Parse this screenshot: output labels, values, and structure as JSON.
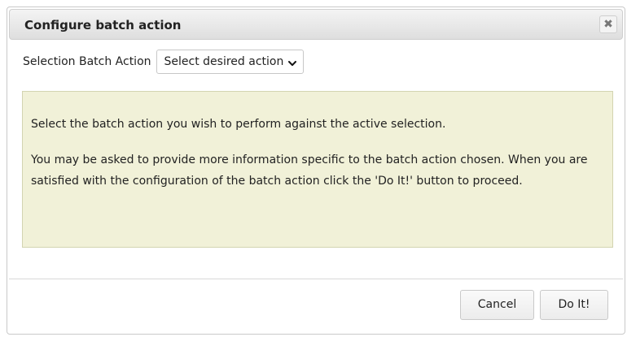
{
  "dialog": {
    "title": "Configure batch action",
    "close_glyph": "✖",
    "close_icon": "close-icon"
  },
  "selection": {
    "label": "Selection Batch Action",
    "selected_value": "Select desired action",
    "dropdown_icon": "chevron-down-icon"
  },
  "info": {
    "paragraph1": "Select the batch action you wish to perform against the active selection.",
    "paragraph2": "You may be asked to provide more information specific to the batch action chosen. When you are satisfied with the configuration of the batch action click the 'Do It!' button to proceed."
  },
  "buttons": {
    "cancel_label": "Cancel",
    "doit_label": "Do It!"
  },
  "colors": {
    "info_background": "#f1f1d8",
    "info_border": "#d3d4b1",
    "titlebar_background": "#e8e8e8"
  }
}
